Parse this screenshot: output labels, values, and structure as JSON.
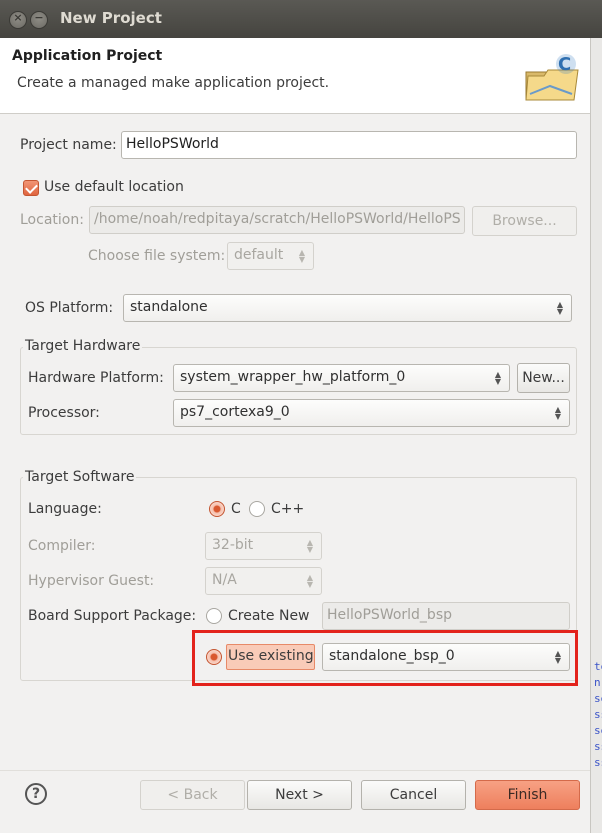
{
  "window": {
    "title": "New Project"
  },
  "header": {
    "title": "Application Project",
    "subtitle": "Create a managed make application project."
  },
  "project": {
    "name_label": "Project name:",
    "name_value": "HelloPSWorld",
    "use_default_location_label": "Use default location",
    "use_default_location_checked": true,
    "location_label": "Location:",
    "location_value": "/home/noah/redpitaya/scratch/HelloPSWorld/HelloPS",
    "browse_label": "Browse...",
    "filesystem_label": "Choose file system:",
    "filesystem_value": "default"
  },
  "os": {
    "label": "OS Platform:",
    "value": "standalone"
  },
  "hardware": {
    "group_title": "Target Hardware",
    "platform_label": "Hardware Platform:",
    "platform_value": "system_wrapper_hw_platform_0",
    "new_label": "New...",
    "processor_label": "Processor:",
    "processor_value": "ps7_cortexa9_0"
  },
  "software": {
    "group_title": "Target Software",
    "language_label": "Language:",
    "lang_c": "C",
    "lang_cpp": "C++",
    "language_selected": "C",
    "compiler_label": "Compiler:",
    "compiler_value": "32-bit",
    "hypervisor_label": "Hypervisor Guest:",
    "hypervisor_value": "N/A",
    "bsp_label": "Board Support Package:",
    "create_new_label": "Create New",
    "create_new_value": "HelloPSWorld_bsp",
    "use_existing_label": "Use existing",
    "use_existing_value": "standalone_bsp_0",
    "bsp_selected": "Use existing"
  },
  "footer": {
    "help_icon": "?",
    "back_label": "< Back",
    "next_label": "Next >",
    "cancel_label": "Cancel",
    "finish_label": "Finish"
  },
  "background_edge_text": [
    "te",
    "n",
    "se",
    "ss",
    "se",
    "ss",
    "ss"
  ],
  "colors": {
    "accent": "#ee7f5d",
    "highlight_box": "#e3231c",
    "titlebar": "#45443f"
  }
}
